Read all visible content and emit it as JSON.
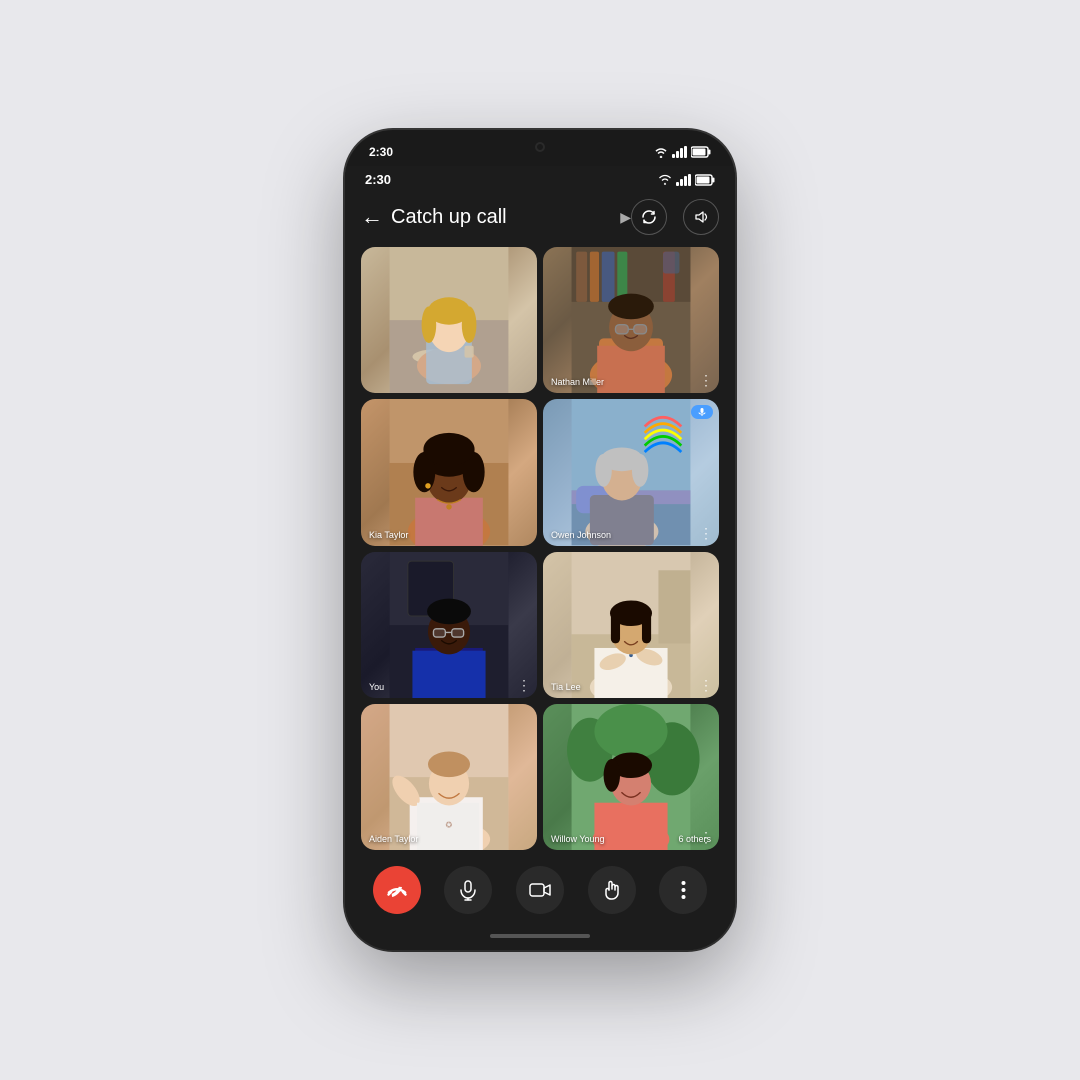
{
  "phone": {
    "status_bar": {
      "time": "2:30",
      "inner_time": "2:30"
    },
    "header": {
      "title": "Catch up call",
      "back_label": "←",
      "arrow_label": "▶"
    },
    "participants": [
      {
        "id": 1,
        "name": "",
        "label": "",
        "has_menu": false,
        "has_badge": false,
        "cell_class": "cell-1"
      },
      {
        "id": 2,
        "name": "Nathan Miller",
        "label": "Nathan Miller",
        "has_menu": true,
        "has_badge": false,
        "cell_class": "cell-2"
      },
      {
        "id": 3,
        "name": "Kia Taylor",
        "label": "Kia Taylor",
        "has_menu": false,
        "has_badge": false,
        "cell_class": "cell-3"
      },
      {
        "id": 4,
        "name": "Owen Johnson",
        "label": "Owen Johnson",
        "has_menu": true,
        "has_badge": true,
        "cell_class": "cell-4"
      },
      {
        "id": 5,
        "name": "You",
        "label": "You",
        "has_menu": true,
        "has_badge": false,
        "cell_class": "cell-5"
      },
      {
        "id": 6,
        "name": "Tia Lee",
        "label": "Tia Lee",
        "has_menu": true,
        "has_badge": false,
        "cell_class": "cell-6"
      },
      {
        "id": 7,
        "name": "Aiden Taylor",
        "label": "Aiden Taylor",
        "has_menu": false,
        "has_badge": false,
        "cell_class": "cell-7"
      },
      {
        "id": 8,
        "name": "Willow Young",
        "label": "Willow Young",
        "others_label": "6 others",
        "has_menu": true,
        "has_badge": false,
        "cell_class": "cell-8"
      }
    ],
    "controls": {
      "end_call_label": "📞",
      "mic_label": "🎤",
      "camera_label": "📹",
      "hand_label": "✋",
      "more_label": "⋮"
    },
    "colors": {
      "end_call": "#ea4335",
      "control_bg": "#2a2a2a",
      "screen_bg": "#1c1c1c",
      "badge_blue": "#4a9eff"
    }
  }
}
